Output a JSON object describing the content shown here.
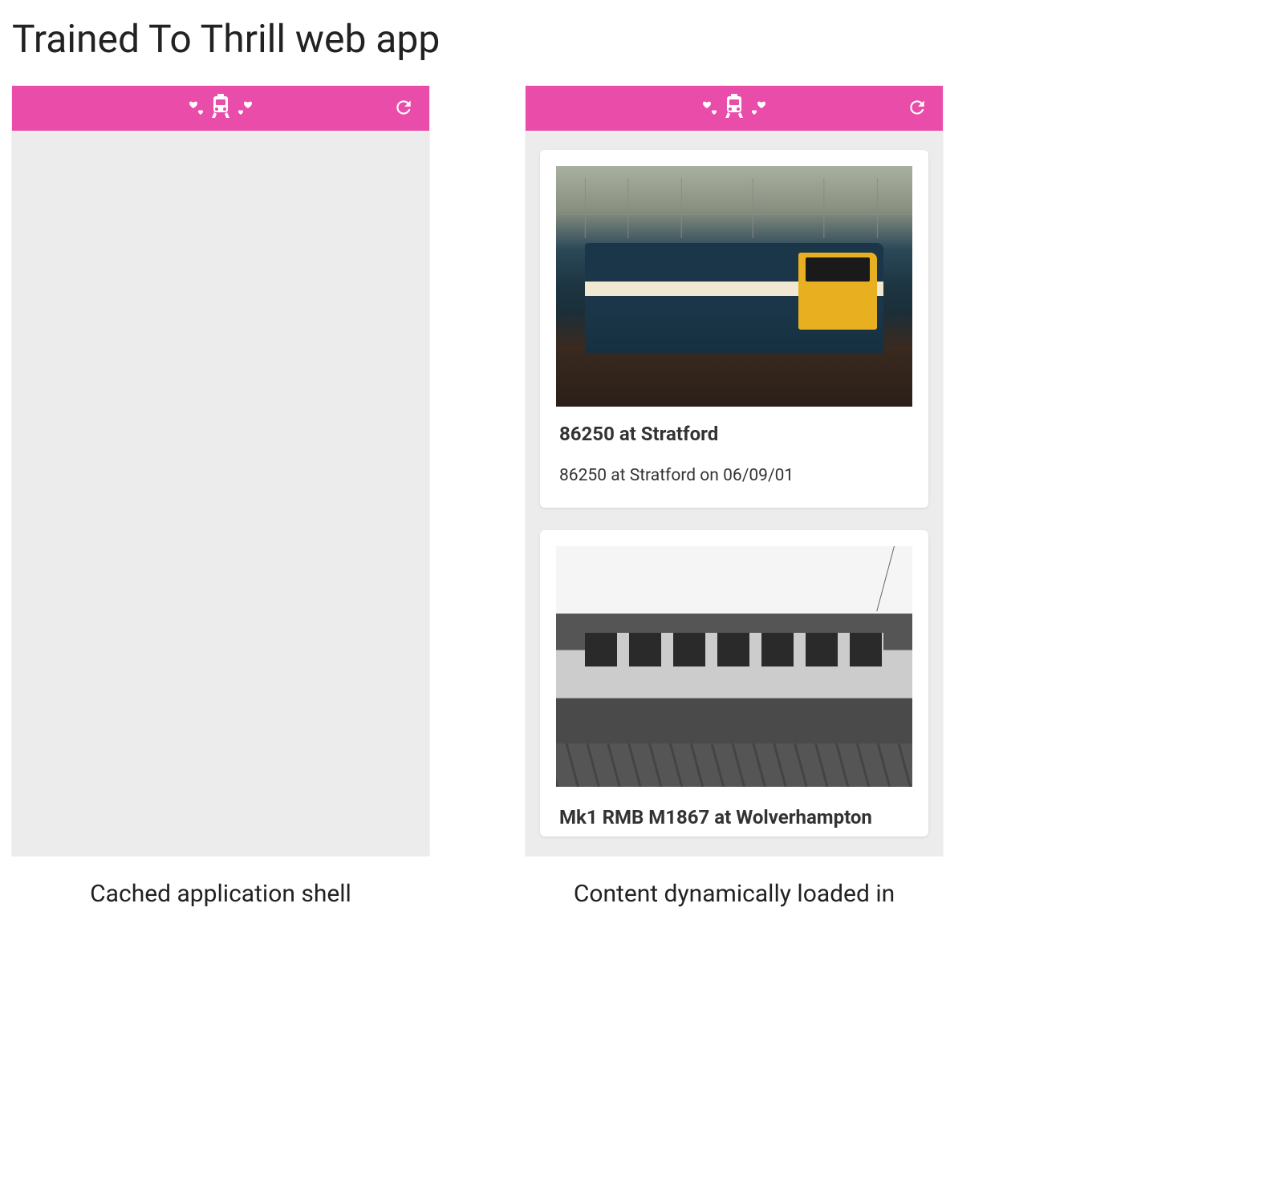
{
  "page_title": "Trained To Thrill web app",
  "header_accent_color": "#e94da9",
  "panels": {
    "left": {
      "caption": "Cached application shell",
      "cards": []
    },
    "right": {
      "caption": "Content dynamically loaded in",
      "cards": [
        {
          "title": "86250 at Stratford",
          "description": "86250 at Stratford on 06/09/01"
        },
        {
          "title": "Mk1 RMB M1867 at Wolverhampton"
        }
      ]
    }
  }
}
